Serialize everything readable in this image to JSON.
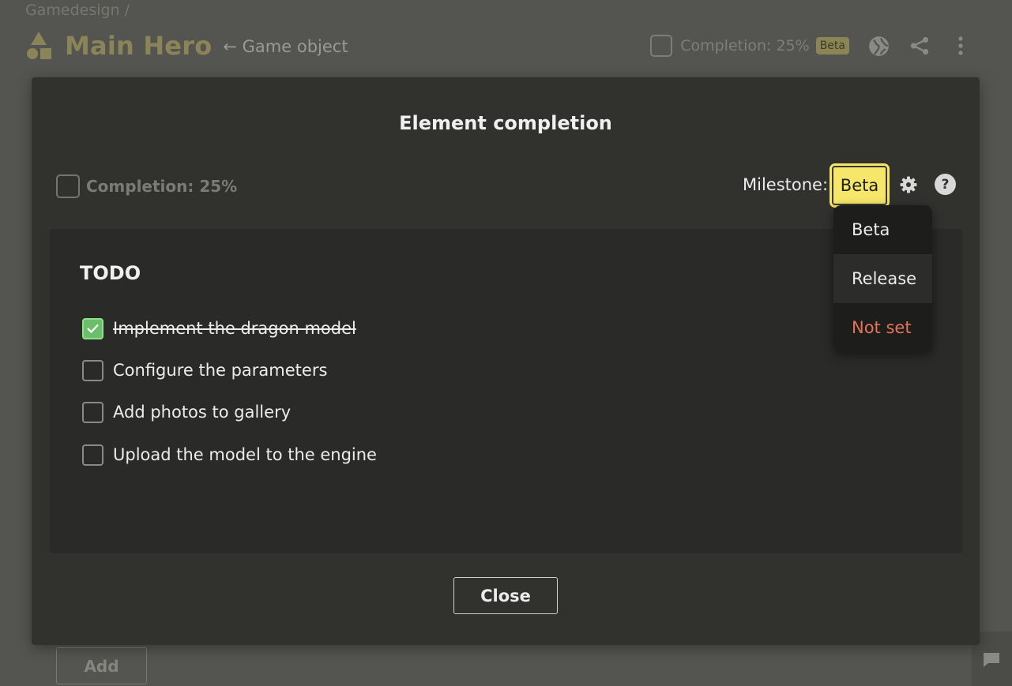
{
  "breadcrumb": "Gamedesign /",
  "header": {
    "title": "Main Hero",
    "subtitle": "← Game object",
    "completion": "Completion: 25%",
    "milestone_badge": "Beta",
    "icons": [
      "globe-icon",
      "share-icon",
      "more-vertical-icon"
    ]
  },
  "modal": {
    "title": "Element completion",
    "completion_label": "Completion: 25%",
    "milestone_label": "Milestone:",
    "milestone_value": "Beta",
    "help_glyph": "?",
    "todo": {
      "title": "TODO",
      "items": [
        {
          "label": "Implement the dragon model",
          "checked": true
        },
        {
          "label": "Configure the parameters",
          "checked": false
        },
        {
          "label": "Add photos to gallery",
          "checked": false
        },
        {
          "label": "Upload the model to the engine",
          "checked": false
        }
      ]
    },
    "close_label": "Close"
  },
  "milestone_dropdown": {
    "options": [
      "Beta",
      "Release",
      "Not set"
    ]
  },
  "add_label": "Add",
  "colors": {
    "milestone_accent": "#f6e66a",
    "checked_green": "#6bbf6a",
    "danger": "#e3735b",
    "title_gold": "#8a8458"
  }
}
